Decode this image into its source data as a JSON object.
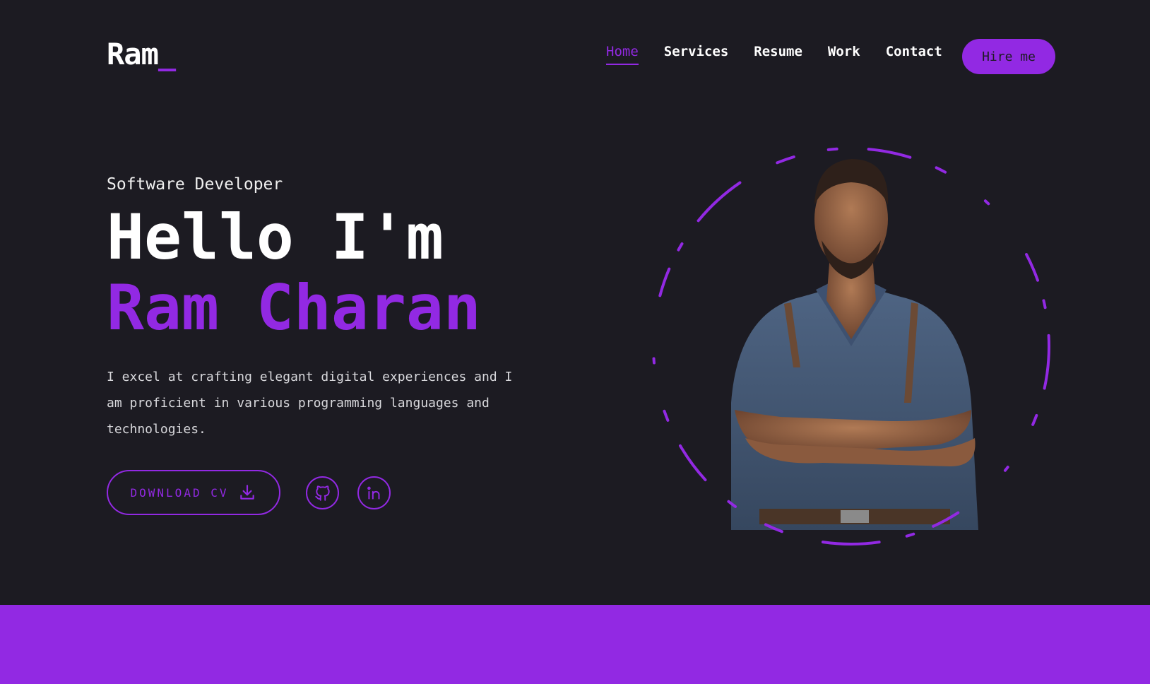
{
  "header": {
    "logo": "Ram",
    "logo_suffix": "_",
    "nav": [
      {
        "label": "Home",
        "active": true
      },
      {
        "label": "Services",
        "active": false
      },
      {
        "label": "Resume",
        "active": false
      },
      {
        "label": "Work",
        "active": false
      },
      {
        "label": "Contact",
        "active": false
      }
    ],
    "hire_label": "Hire me"
  },
  "hero": {
    "role": "Software Developer",
    "greeting": "Hello I'm",
    "name": "Ram Charan",
    "description": "I excel at crafting elegant digital experiences and I am proficient in various programming languages and technologies.",
    "cv_label": "DOWNLOAD CV",
    "cv_icon": "download-icon",
    "socials": [
      {
        "name": "github-icon"
      },
      {
        "name": "linkedin-icon"
      }
    ]
  },
  "colors": {
    "accent": "#9229e3",
    "background": "#1c1b22",
    "text": "#ffffff"
  }
}
